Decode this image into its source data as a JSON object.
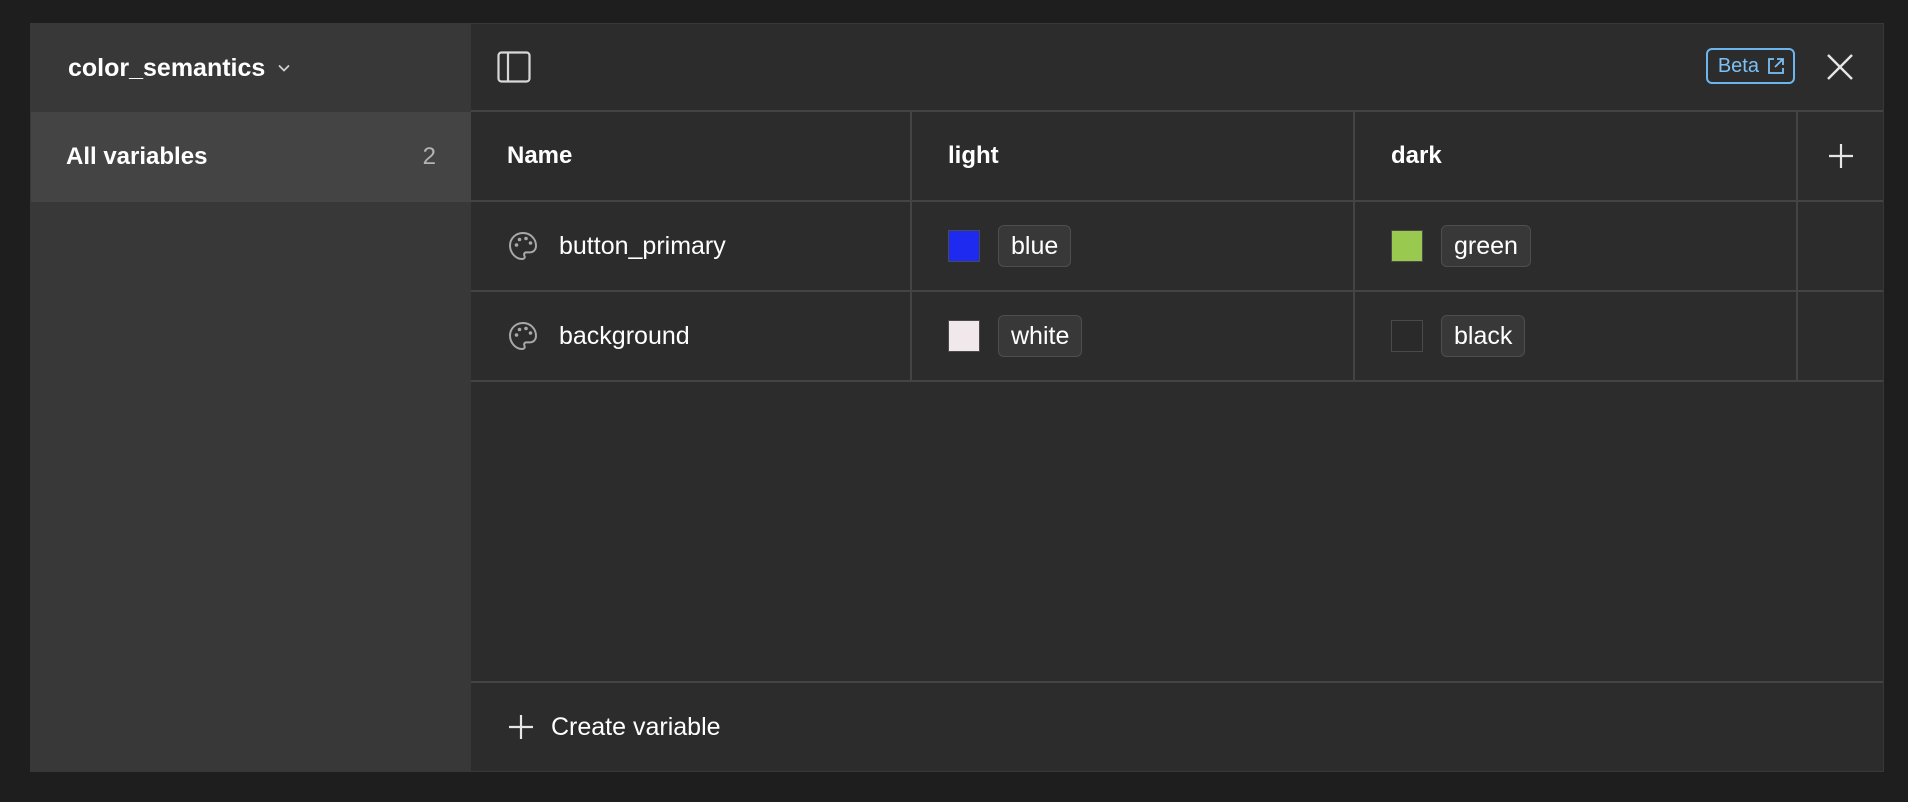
{
  "sidebar": {
    "collection_name": "color_semantics",
    "items": [
      {
        "label": "All variables",
        "count": "2"
      }
    ]
  },
  "topbar": {
    "beta_label": "Beta"
  },
  "table": {
    "columns": [
      "Name",
      "light",
      "dark"
    ],
    "rows": [
      {
        "name": "button_primary",
        "light": {
          "label": "blue",
          "color": "#1f2af0"
        },
        "dark": {
          "label": "green",
          "color": "#9ac94f"
        }
      },
      {
        "name": "background",
        "light": {
          "label": "white",
          "color": "#f0e8ea"
        },
        "dark": {
          "label": "black",
          "color": "#2a2a2a"
        }
      }
    ]
  },
  "footer": {
    "create_label": "Create variable"
  },
  "colors": {
    "accent": "#6cb6f0",
    "panel": "#2c2c2c",
    "sidebar": "#383838"
  },
  "icons": {
    "collection_dropdown": "chevron-down-icon",
    "panel_toggle": "sidebar-panel-icon",
    "external_link": "external-link-icon",
    "close": "close-icon",
    "variable_type": "palette-icon",
    "add": "plus-icon"
  }
}
